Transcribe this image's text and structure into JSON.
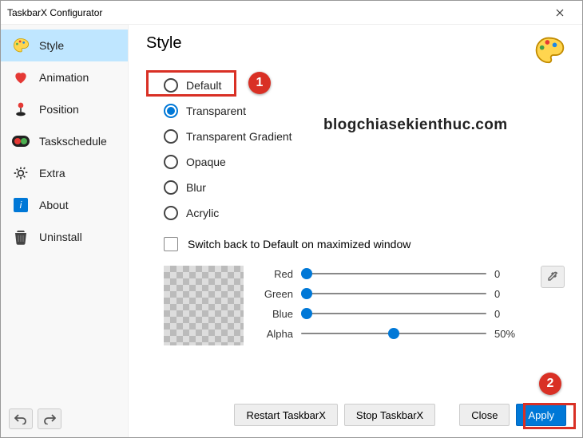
{
  "window": {
    "title": "TaskbarX Configurator"
  },
  "sidebar": {
    "items": [
      {
        "label": "Style"
      },
      {
        "label": "Animation"
      },
      {
        "label": "Position"
      },
      {
        "label": "Taskschedule"
      },
      {
        "label": "Extra"
      },
      {
        "label": "About"
      },
      {
        "label": "Uninstall"
      }
    ],
    "selectedIndex": 0
  },
  "main": {
    "title": "Style",
    "options": [
      {
        "label": "Default"
      },
      {
        "label": "Transparent"
      },
      {
        "label": "Transparent Gradient"
      },
      {
        "label": "Opaque"
      },
      {
        "label": "Blur"
      },
      {
        "label": "Acrylic"
      }
    ],
    "selectedOption": 1,
    "checkbox": {
      "label": "Switch back to Default on maximized window",
      "checked": false
    },
    "sliders": {
      "red": {
        "label": "Red",
        "value": 0,
        "display": "0",
        "pct": 3
      },
      "green": {
        "label": "Green",
        "value": 0,
        "display": "0",
        "pct": 3
      },
      "blue": {
        "label": "Blue",
        "value": 0,
        "display": "0",
        "pct": 3
      },
      "alpha": {
        "label": "Alpha",
        "value": 50,
        "display": "50%",
        "pct": 50
      }
    }
  },
  "buttons": {
    "restart": "Restart TaskbarX",
    "stop": "Stop TaskbarX",
    "close": "Close",
    "apply": "Apply"
  },
  "annotations": {
    "one": "1",
    "two": "2"
  },
  "watermark": "blogchiasekienthuc.com"
}
